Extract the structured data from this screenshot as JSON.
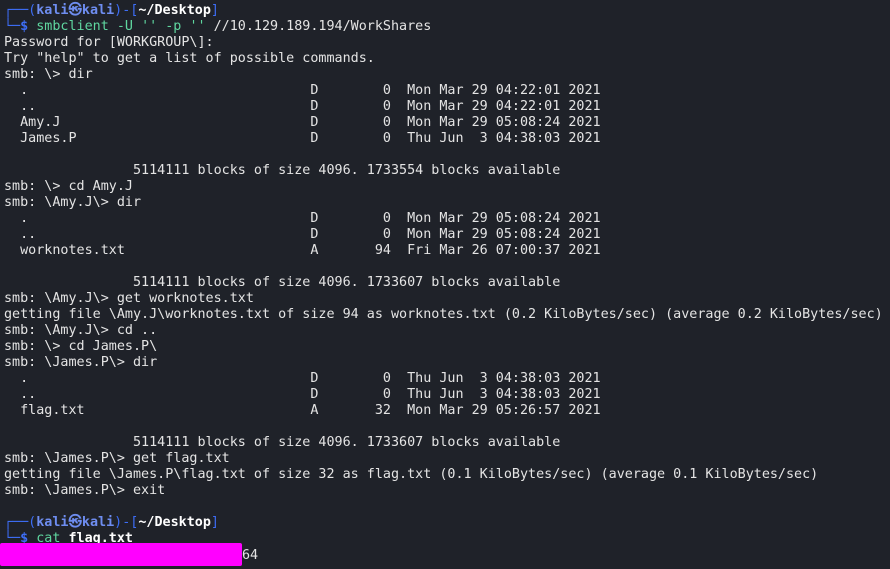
{
  "terminal": {
    "prompt1": {
      "box_top": "┌──(",
      "user": "kali",
      "at": "㉿",
      "host": "kali",
      "mid": ")-[",
      "path": "~/Desktop",
      "end": "]",
      "box_bottom": "└─",
      "dollar": "$",
      "cmd": "smbclient",
      "flag1": "-U",
      "q1": "''",
      "flag2": "-p",
      "q2": "''",
      "target": "//10.129.189.194/WorkShares"
    },
    "lines": [
      "Password for [WORKGROUP\\]:",
      "Try \"help\" to get a list of possible commands.",
      "smb: \\> dir",
      "  .                                   D        0  Mon Mar 29 04:22:01 2021",
      "  ..                                  D        0  Mon Mar 29 04:22:01 2021",
      "  Amy.J                               D        0  Mon Mar 29 05:08:24 2021",
      "  James.P                             D        0  Thu Jun  3 04:38:03 2021",
      "",
      "                5114111 blocks of size 4096. 1733554 blocks available",
      "smb: \\> cd Amy.J",
      "smb: \\Amy.J\\> dir",
      "  .                                   D        0  Mon Mar 29 05:08:24 2021",
      "  ..                                  D        0  Mon Mar 29 05:08:24 2021",
      "  worknotes.txt                       A       94  Fri Mar 26 07:00:37 2021",
      "",
      "                5114111 blocks of size 4096. 1733607 blocks available",
      "smb: \\Amy.J\\> get worknotes.txt",
      "getting file \\Amy.J\\worknotes.txt of size 94 as worknotes.txt (0.2 KiloBytes/sec) (average 0.2 KiloBytes/sec)",
      "smb: \\Amy.J\\> cd ..",
      "smb: \\> cd James.P\\",
      "smb: \\James.P\\> dir",
      "  .                                   D        0  Thu Jun  3 04:38:03 2021",
      "  ..                                  D        0  Thu Jun  3 04:38:03 2021",
      "  flag.txt                            A       32  Mon Mar 29 05:26:57 2021",
      "",
      "                5114111 blocks of size 4096. 1733607 blocks available",
      "smb: \\James.P\\> get flag.txt",
      "getting file \\James.P\\flag.txt of size 32 as flag.txt (0.1 KiloBytes/sec) (average 0.1 KiloBytes/sec)",
      "smb: \\James.P\\> exit"
    ],
    "prompt2": {
      "box_top": "┌──(",
      "user": "kali",
      "at": "㉿",
      "host": "kali",
      "mid": ")-[",
      "path": "~/Desktop",
      "end": "]",
      "box_bottom": "└─",
      "dollar": "$",
      "cmd": "cat",
      "arg": "flag.txt"
    },
    "flag_tail": "64",
    "colors": {
      "background": "#1f2229",
      "prompt_blue": "#3d6df5",
      "command_green": "#5fd7a0",
      "redaction": "#ff00ff"
    }
  }
}
